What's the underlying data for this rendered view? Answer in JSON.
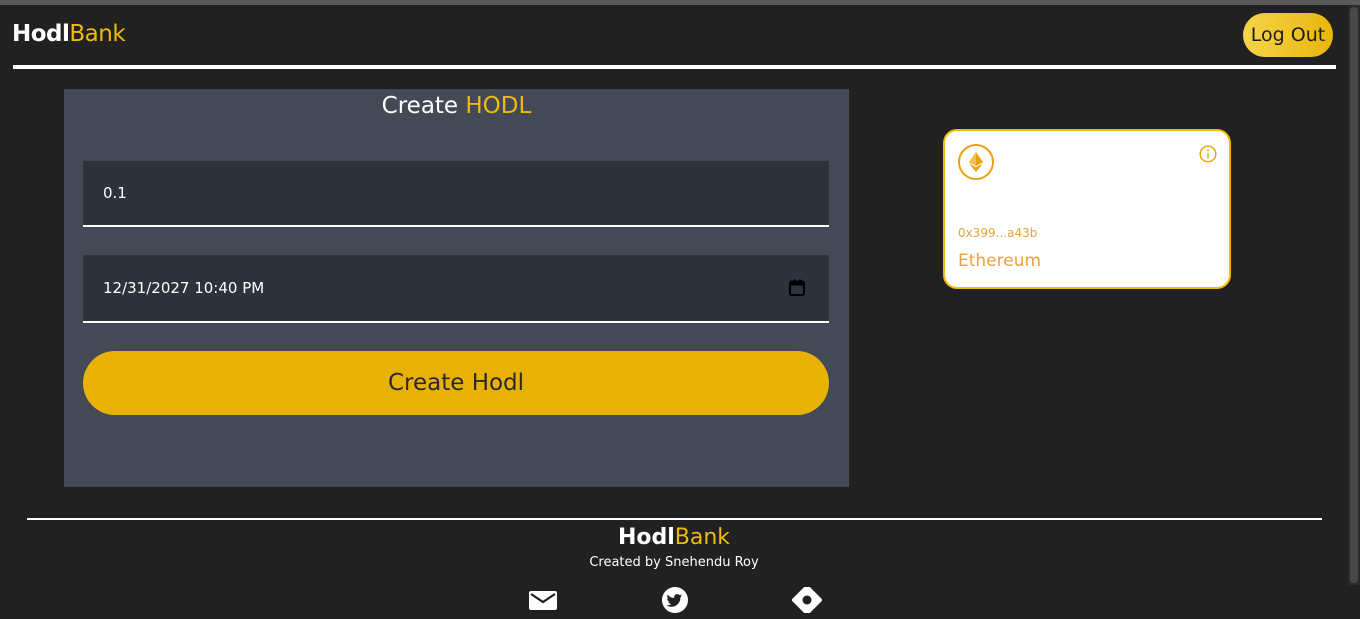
{
  "header": {
    "logo_part1": "Hodl",
    "logo_part2": "Bank",
    "logout_label": "Log Out"
  },
  "create_panel": {
    "title_part1": "Create ",
    "title_part2": "HODL",
    "amount_value": "0.1",
    "unlock_datetime_value": "12/31/2027 10:40 PM",
    "calendar_icon": "calendar-icon",
    "submit_label": "Create Hodl"
  },
  "wallet_card": {
    "icon": "ethereum-icon",
    "info_icon": "info-icon",
    "address": "0x399...a43b",
    "network": "Ethereum"
  },
  "footer": {
    "logo_part1": "Hodl",
    "logo_part2": "Bank",
    "credit": "Created by Snehendu Roy",
    "social_icons": [
      "mail-icon",
      "twitter-icon",
      "hashnode-icon"
    ]
  },
  "colors": {
    "accent": "#f0b90b",
    "background": "#212121",
    "panel": "#434a56",
    "field": "#2d333c",
    "card_text": "#e8a23c"
  }
}
